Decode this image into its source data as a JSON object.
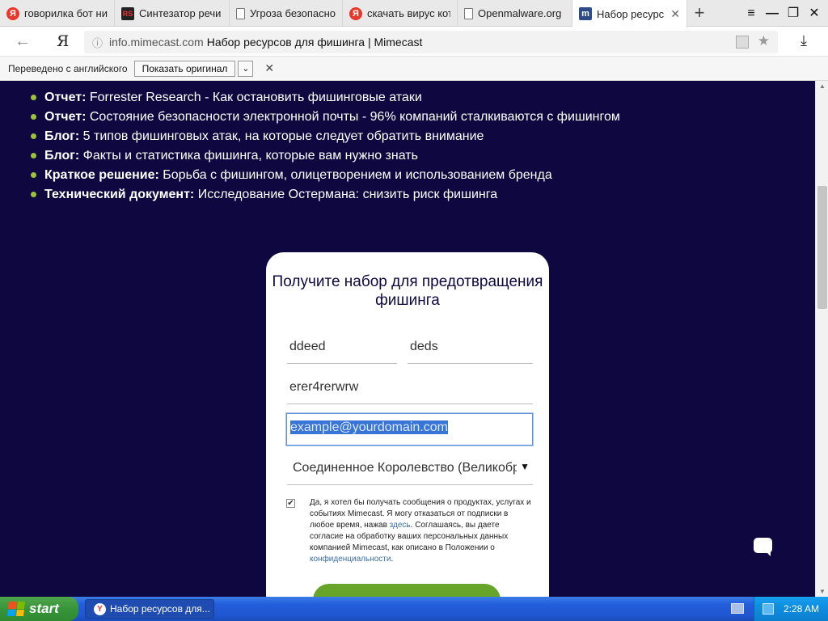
{
  "browser": {
    "tabs": [
      {
        "label": "говорилка бот ни",
        "icon": "yandex-icon",
        "active": false
      },
      {
        "label": "Синтезатор речи",
        "icon": "rs-icon",
        "active": false
      },
      {
        "label": "Угроза безопасно",
        "icon": "document-icon",
        "active": false
      },
      {
        "label": "скачать вирус кот",
        "icon": "yandex-icon",
        "active": false
      },
      {
        "label": "Openmalware.org",
        "icon": "document-icon",
        "active": false
      },
      {
        "label": "Набор ресурсо",
        "icon": "mimecast-icon",
        "active": true
      }
    ],
    "new_tab": "+",
    "window_buttons": [
      "≡",
      "—",
      "❐",
      "✕"
    ],
    "address": {
      "host": "info.mimecast.com",
      "page_title": "Набор ресурсов для фишинга | Mimecast"
    },
    "yandex_logo": "Я"
  },
  "translate_bar": {
    "label": "Переведено с английского",
    "show_original": "Показать оригинал",
    "dropdown": "⌄",
    "close": "✕"
  },
  "resources": [
    {
      "kind": "Отчет:",
      "text": " Forrester Research - Как остановить фишинговые атаки"
    },
    {
      "kind": "Отчет:",
      "text": " Состояние безопасности электронной почты - 96% компаний сталкиваются с фишингом"
    },
    {
      "kind": "Блог:",
      "text": " 5 типов фишинговых атак, на которые следует обратить внимание"
    },
    {
      "kind": "Блог:",
      "text": " Факты и статистика фишинга, которые вам нужно знать"
    },
    {
      "kind": "Краткое решение:",
      "text": " Борьба с фишингом, олицетворением и использованием бренда"
    },
    {
      "kind": "Технический документ:",
      "text": " Исследование Остермана: снизить риск фишинга"
    }
  ],
  "form": {
    "heading": "Получите набор для предотвращения фишинга",
    "first_name": "ddeed",
    "last_name": "deds",
    "company": "erer4rerwrw",
    "email": "example@yourdomain.com",
    "country": "Соединенное Королевство (Великобр",
    "consent_checked": true,
    "consent_text_1": "Да, я хотел бы получать сообщения о продуктах, услугах и событиях Mimecast. Я могу отказаться от подписки в любое время, нажав ",
    "consent_link_1": "здесь",
    "consent_text_2": ". Соглашаясь, вы даете согласие на обработку ваших персональных данных компанией Mimecast, как описано в Положении о ",
    "consent_link_2": "конфиденциальности",
    "consent_text_3": "."
  },
  "taskbar": {
    "start": "start",
    "task_item": "Набор ресурсов для...",
    "clock": "2:28 AM"
  },
  "colors": {
    "page_background": "#0e0740",
    "bullet_green": "#9bc43a",
    "submit_green": "#67a52a",
    "selection_blue": "#3875d7"
  }
}
